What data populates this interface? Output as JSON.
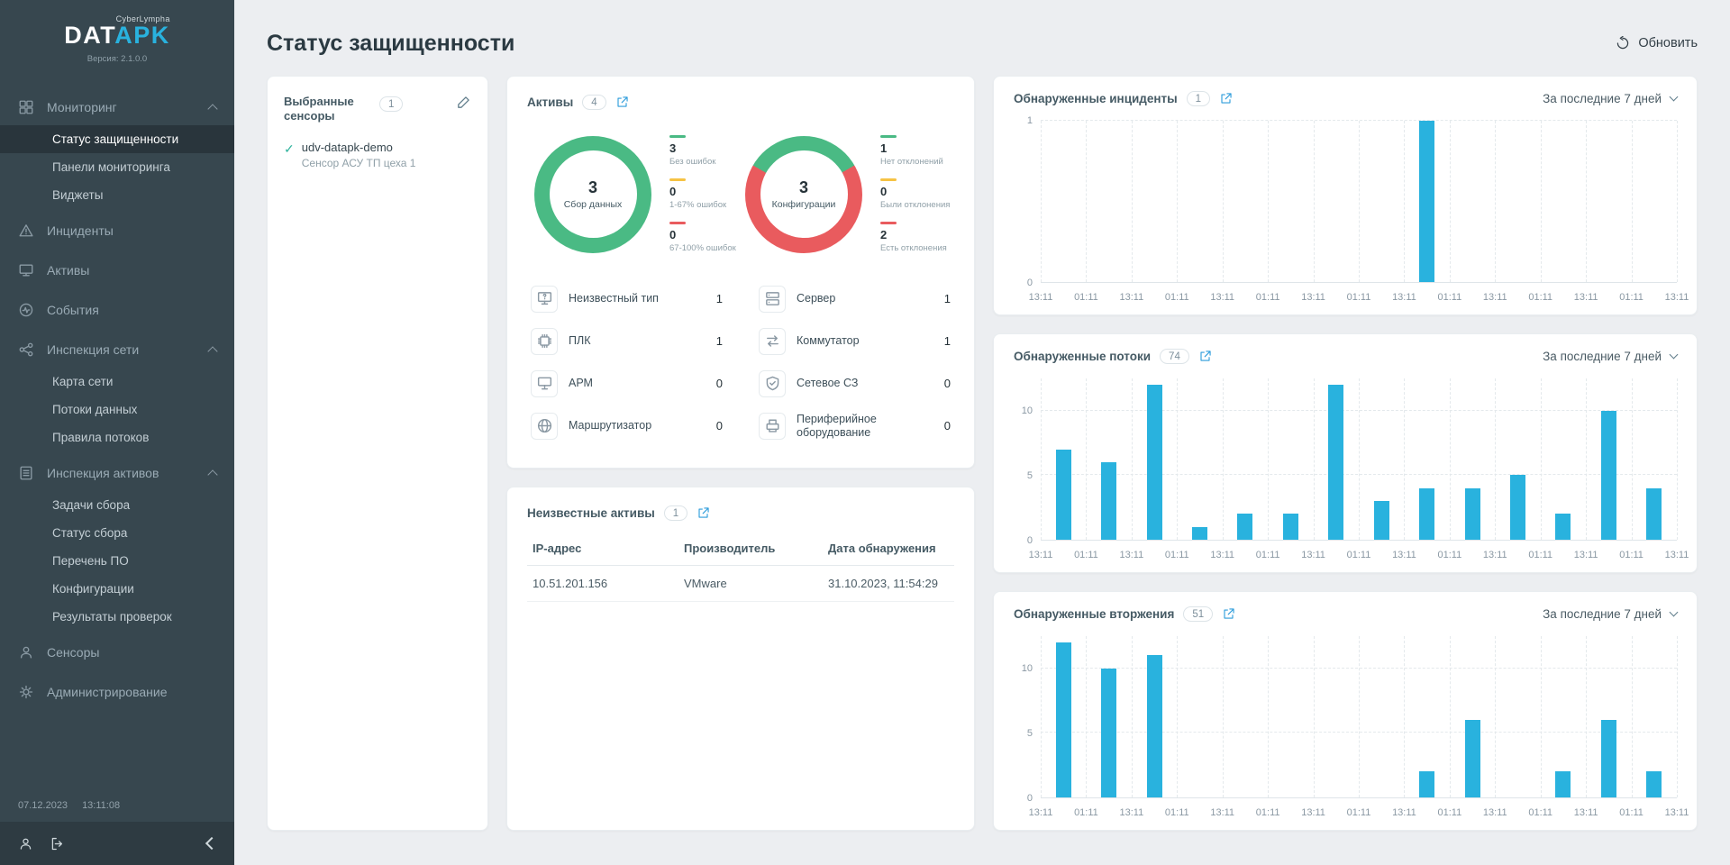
{
  "colors": {
    "accent": "#29b2de",
    "green": "#4aba84",
    "red": "#e95b5e",
    "yellow": "#f6c344",
    "link": "#2d9cdb"
  },
  "app": {
    "logo_main": "DAT",
    "logo_accent": "APK",
    "logo_tag": "CyberLympha",
    "version": "Версия: 2.1.0.0",
    "date": "07.12.2023",
    "time": "13:11:08"
  },
  "sidebar": {
    "menu": [
      {
        "icon": "dashboard",
        "label": "Мониторинг",
        "expanded": true,
        "children": [
          {
            "label": "Статус защищенности",
            "active": true
          },
          {
            "label": "Панели мониторинга"
          },
          {
            "label": "Виджеты"
          }
        ]
      },
      {
        "icon": "warning",
        "label": "Инциденты"
      },
      {
        "icon": "monitor",
        "label": "Активы"
      },
      {
        "icon": "events",
        "label": "События"
      },
      {
        "icon": "network",
        "label": "Инспекция сети",
        "expanded": true,
        "children": [
          {
            "label": "Карта сети"
          },
          {
            "label": "Потоки данных"
          },
          {
            "label": "Правила потоков"
          }
        ]
      },
      {
        "icon": "list",
        "label": "Инспекция активов",
        "expanded": true,
        "children": [
          {
            "label": "Задачи сбора"
          },
          {
            "label": "Статус сбора"
          },
          {
            "label": "Перечень ПО"
          },
          {
            "label": "Конфигурации"
          },
          {
            "label": "Результаты проверок"
          }
        ]
      },
      {
        "icon": "sensors",
        "label": "Сенсоры"
      },
      {
        "icon": "gear",
        "label": "Администрирование"
      }
    ]
  },
  "header": {
    "title": "Статус защищенности",
    "refresh_label": "Обновить"
  },
  "sensors_panel": {
    "title": "Выбранные сенсоры",
    "badge": "1",
    "items": [
      {
        "name": "udv-datapk-demo",
        "description": "Сенсор АСУ ТП цеха 1"
      }
    ]
  },
  "assets_card": {
    "title": "Активы",
    "badge": "4",
    "donuts": [
      {
        "center_value": "3",
        "center_label": "Сбор данных",
        "segments": [
          {
            "color": "green",
            "value": 3
          }
        ],
        "legend": [
          {
            "color": "green",
            "value": "3",
            "label": "Без ошибок"
          },
          {
            "color": "yellow",
            "value": "0",
            "label": "1-67% ошибок"
          },
          {
            "color": "red",
            "value": "0",
            "label": "67-100% ошибок"
          }
        ]
      },
      {
        "center_value": "3",
        "center_label": "Конфигурации",
        "segments": [
          {
            "color": "green",
            "value": 1
          },
          {
            "color": "red",
            "value": 2
          }
        ],
        "legend": [
          {
            "color": "green",
            "value": "1",
            "label": "Нет отклонений"
          },
          {
            "color": "yellow",
            "value": "0",
            "label": "Были отклонения"
          },
          {
            "color": "red",
            "value": "2",
            "label": "Есть отклонения"
          }
        ]
      }
    ],
    "types": [
      {
        "icon": "unknown",
        "label": "Неизвестный тип",
        "value": "1"
      },
      {
        "icon": "server",
        "label": "Сервер",
        "value": "1"
      },
      {
        "icon": "plc",
        "label": "ПЛК",
        "value": "1"
      },
      {
        "icon": "switch",
        "label": "Коммутатор",
        "value": "1"
      },
      {
        "icon": "arm",
        "label": "АРМ",
        "value": "0"
      },
      {
        "icon": "shield",
        "label": "Сетевое СЗ",
        "value": "0"
      },
      {
        "icon": "router",
        "label": "Маршрутизатор",
        "value": "0"
      },
      {
        "icon": "peripheral",
        "label": "Периферийное оборудование",
        "value": "0"
      }
    ]
  },
  "unknown_assets_card": {
    "title": "Неизвестные активы",
    "badge": "1",
    "columns": [
      "IP-адрес",
      "Производитель",
      "Дата обнаружения"
    ],
    "rows": [
      [
        "10.51.201.156",
        "VMware",
        "31.10.2023, 11:54:29"
      ]
    ]
  },
  "chart_data": [
    {
      "id": "incidents",
      "type": "bar",
      "title": "Обнаруженные инциденты",
      "badge": "1",
      "period": "За последние 7 дней",
      "x_ticks": [
        "13:11",
        "01:11",
        "13:11",
        "01:11",
        "13:11",
        "01:11",
        "13:11",
        "01:11",
        "13:11",
        "01:11",
        "13:11",
        "01:11",
        "13:11",
        "01:11",
        "13:11"
      ],
      "values": [
        0,
        0,
        0,
        0,
        0,
        0,
        0,
        0,
        1,
        0,
        0,
        0,
        0,
        0
      ],
      "y_ticks": [
        0,
        1
      ],
      "ylim": [
        0,
        1
      ],
      "grid": true,
      "legend_position": "none"
    },
    {
      "id": "flows",
      "type": "bar",
      "title": "Обнаруженные потоки",
      "badge": "74",
      "period": "За последние 7 дней",
      "x_ticks": [
        "13:11",
        "01:11",
        "13:11",
        "01:11",
        "13:11",
        "01:11",
        "13:11",
        "01:11",
        "13:11",
        "01:11",
        "13:11",
        "01:11",
        "13:11",
        "01:11",
        "13:11"
      ],
      "values": [
        7,
        6,
        12,
        1,
        2,
        2,
        12,
        3,
        4,
        4,
        5,
        2,
        10,
        4
      ],
      "y_ticks": [
        0,
        5,
        10
      ],
      "ylim": [
        0,
        12.5
      ],
      "grid": true,
      "legend_position": "none"
    },
    {
      "id": "intrusions",
      "type": "bar",
      "title": "Обнаруженные вторжения",
      "badge": "51",
      "period": "За последние 7 дней",
      "x_ticks": [
        "13:11",
        "01:11",
        "13:11",
        "01:11",
        "13:11",
        "01:11",
        "13:11",
        "01:11",
        "13:11",
        "01:11",
        "13:11",
        "01:11",
        "13:11",
        "01:11",
        "13:11"
      ],
      "values": [
        12,
        10,
        11,
        0,
        0,
        0,
        0,
        0,
        2,
        6,
        0,
        2,
        6,
        2
      ],
      "y_ticks": [
        0,
        5,
        10
      ],
      "ylim": [
        0,
        12.5
      ],
      "grid": true,
      "legend_position": "none"
    }
  ]
}
